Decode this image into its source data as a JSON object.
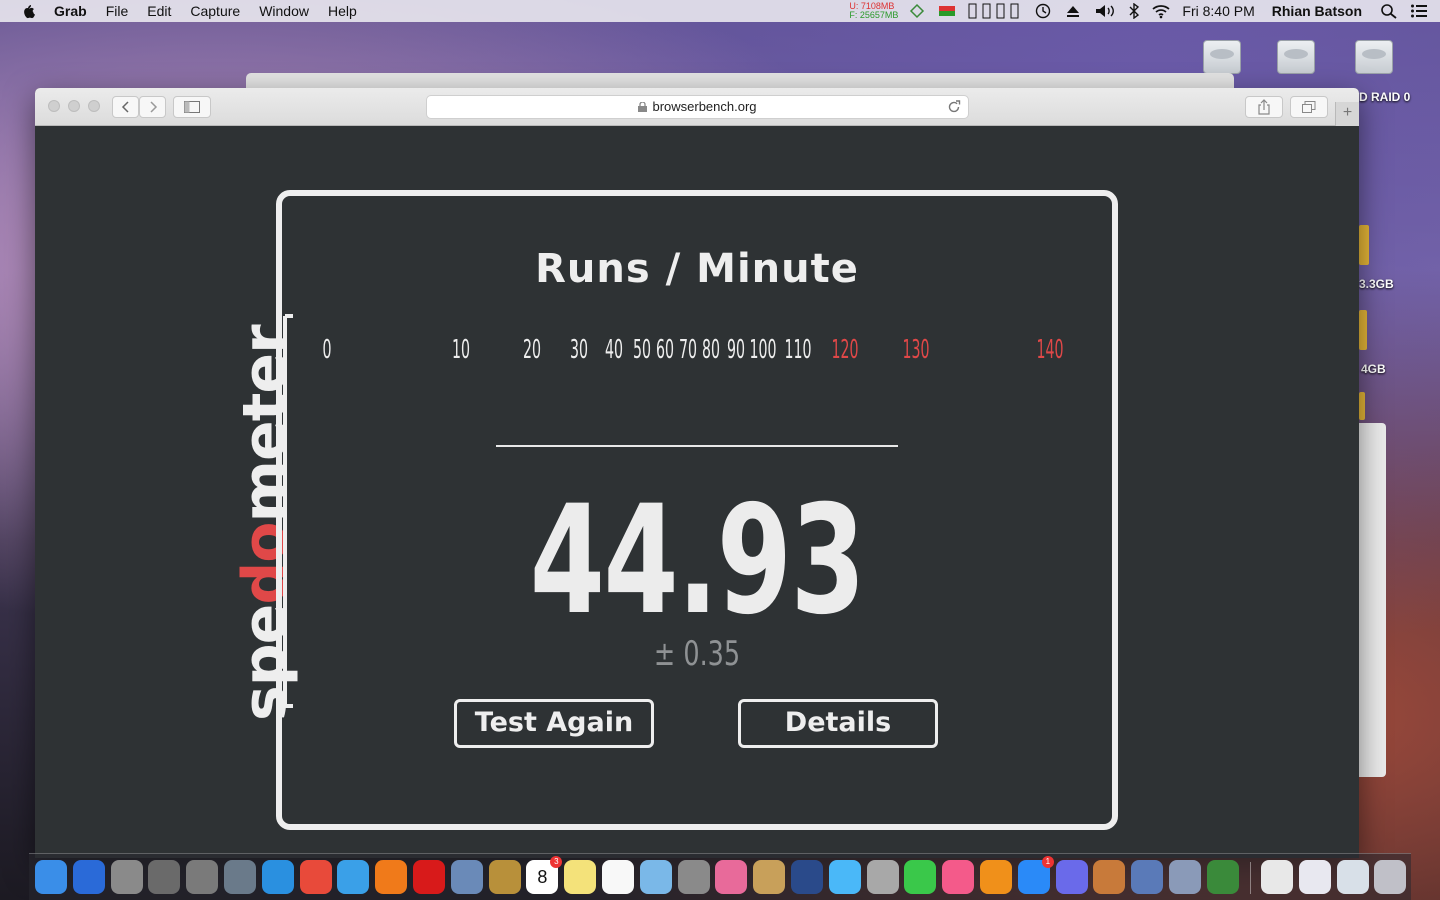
{
  "menubar": {
    "app": "Grab",
    "items": [
      "File",
      "Edit",
      "Capture",
      "Window",
      "Help"
    ],
    "memory_u": "U:    7108MB",
    "memory_f": "F:  25657MB",
    "clock": "Fri 8:40 PM",
    "user": "Rhian Batson",
    "icons": [
      "apple-icon",
      "network-status-icon",
      "battery-icon",
      "time-machine-icon",
      "eject-icon",
      "volume-icon",
      "bluetooth-icon",
      "wifi-icon",
      "spotlight-icon",
      "notification-center-icon"
    ]
  },
  "desktop": {
    "labels": [
      "D RAID 0",
      "3.3GB",
      "4GB"
    ]
  },
  "browser": {
    "url": "browserbench.org"
  },
  "speedometer": {
    "logo": "speedometer",
    "title": "Runs / Minute",
    "score": "44.93",
    "error": "± 0.35",
    "score_value": 44.93,
    "buttons": {
      "test_again": "Test Again",
      "details": "Details"
    },
    "gauge_labels": [
      "0",
      "10",
      "20",
      "30",
      "40",
      "50",
      "60",
      "70",
      "80",
      "90",
      "100",
      "110",
      "120",
      "130",
      "140"
    ],
    "colors": {
      "normal": "#eeeeee",
      "red": "#e04848",
      "needle": "#f0962c",
      "background": "#2e3234"
    }
  },
  "dock": {
    "apps": [
      "finder",
      "xcode",
      "utilities",
      "jump",
      "system-preferences",
      "launchpad",
      "safari",
      "chrome",
      "safari-tech-preview",
      "firefox",
      "opera",
      "preview",
      "contacts",
      "calendar",
      "notes",
      "reminders",
      "photos-browser",
      "calculator",
      "photos",
      "logic",
      "canary",
      "messages",
      "grab",
      "facetime",
      "itunes",
      "ibooks",
      "app-store",
      "discord",
      "garageband",
      "keynote",
      "instruments",
      "activity-monitor",
      "documents",
      "screenshots",
      "preview-screens",
      "trash"
    ],
    "calendar_day": "8",
    "calendar_badge": "3",
    "appstore_badge": "1"
  }
}
